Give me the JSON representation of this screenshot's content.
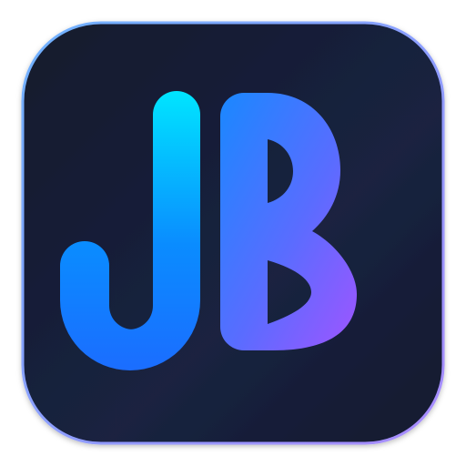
{
  "app_icon": {
    "monogram": "JB",
    "colors": {
      "tile_background_top": "#1a2240",
      "tile_background_bottom": "#121a2e",
      "border_start": "#6fb2ff",
      "border_end": "#a98bff",
      "letter_gradient_start": "#00e5ff",
      "letter_gradient_mid": "#1c7dff",
      "letter_gradient_end": "#9a55ff"
    }
  }
}
